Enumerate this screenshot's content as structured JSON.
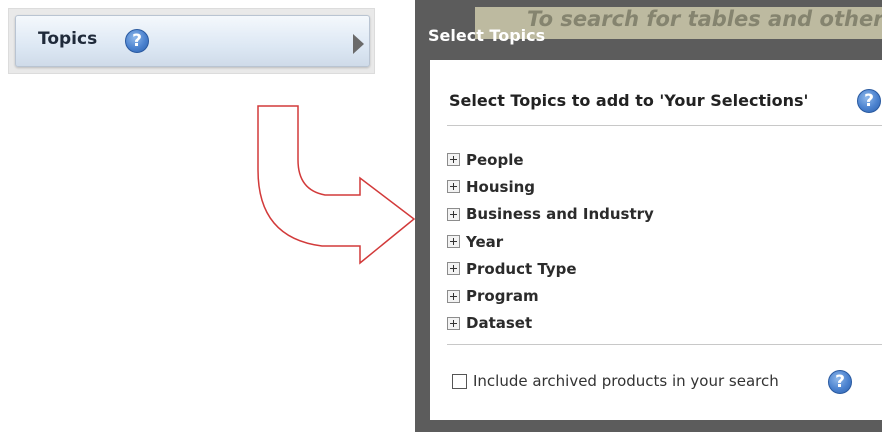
{
  "topics_button": {
    "label": "Topics",
    "help_glyph": "?"
  },
  "background_hint": {
    "text": "To search for tables and other"
  },
  "dialog": {
    "title": "Select Topics",
    "heading": "Select Topics to add to 'Your Selections'",
    "help_glyph": "?",
    "topics": [
      {
        "label": "People"
      },
      {
        "label": "Housing"
      },
      {
        "label": "Business and Industry"
      },
      {
        "label": "Year"
      },
      {
        "label": "Product Type"
      },
      {
        "label": "Program"
      },
      {
        "label": "Dataset"
      }
    ],
    "archive_option": {
      "label": "Include archived products in your search",
      "checked": false
    }
  },
  "colors": {
    "arrow_outline": "#d23a3a",
    "help_icon": "#4b82cf",
    "modal_backdrop": "#5c5c5c"
  }
}
